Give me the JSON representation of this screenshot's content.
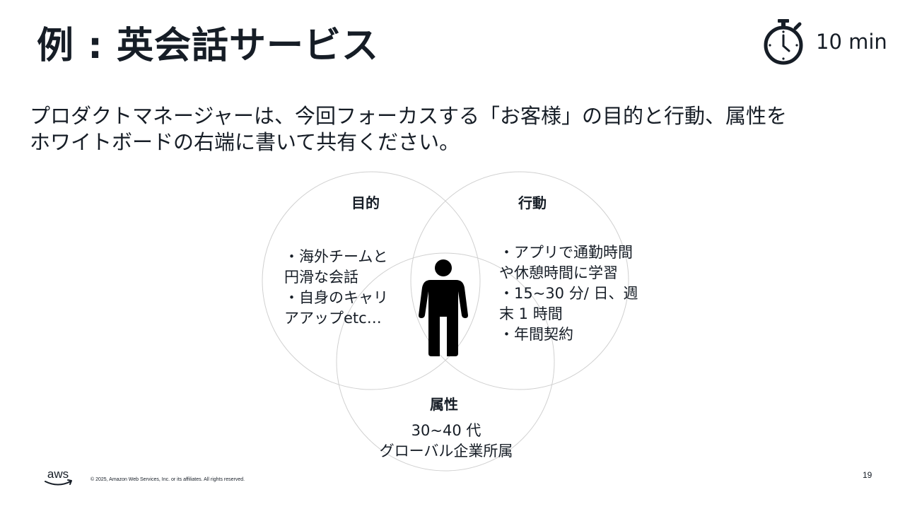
{
  "slide": {
    "title": "例 : 英会話サービス",
    "timer_text": "10 min",
    "instructions_line1": "プロダクトマネージャーは、今回フォーカスする「お客様」の目的と行動、属性を",
    "instructions_line2": "ホワイトボードの右端に書いて共有ください。",
    "page_number": "19"
  },
  "venn": {
    "purpose": {
      "label": "目的",
      "lines": [
        "・海外チームと",
        "円滑な会話",
        "・自身のキャリ",
        "アアップetc…"
      ]
    },
    "behavior": {
      "label": "行動",
      "lines": [
        "・アプリで通勤時間",
        "や休憩時間に学習",
        "・15~30 分/ 日、週",
        "末 1 時間",
        "・年間契約"
      ]
    },
    "attributes": {
      "label": "属性",
      "lines": [
        "30~40 代",
        "グローバル企業所属"
      ]
    }
  },
  "footer": {
    "logo_text": "aws",
    "copyright": "© 2025, Amazon Web Services, Inc. or its affiliates. All rights reserved."
  },
  "icons": {
    "timer": "stopwatch-icon",
    "person": "person-icon",
    "logo": "aws-logo"
  }
}
